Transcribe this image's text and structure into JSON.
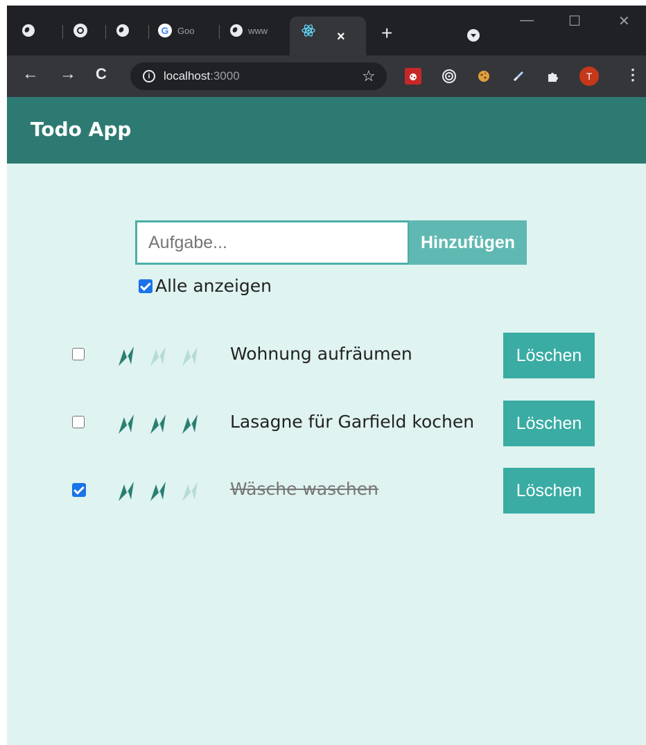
{
  "browser": {
    "tabs": [
      {
        "icon": "globe-icon",
        "title": ""
      },
      {
        "icon": "whatsapp-icon",
        "title": ""
      },
      {
        "icon": "globe-icon",
        "title": ""
      },
      {
        "icon": "google-icon",
        "title": "Goo"
      },
      {
        "icon": "globe-icon",
        "title": "www"
      },
      {
        "icon": "react-icon",
        "title": "",
        "active": true,
        "close": "×"
      }
    ],
    "new_tab": "+",
    "window_controls": {
      "minimize": "—",
      "maximize": "☐",
      "close": "✕"
    },
    "nav": {
      "back": "←",
      "forward": "→",
      "reload": "C"
    },
    "address": {
      "host": "localhost",
      "port": ":3000",
      "info": "i"
    },
    "bookmark_star": "☆",
    "profile_initial": "T",
    "menu": "⋮"
  },
  "app": {
    "title": "Todo App",
    "input_placeholder": "Aufgabe...",
    "add_label": "Hinzufügen",
    "show_all_label": "Alle anzeigen",
    "show_all_checked": true,
    "accent": "#2d7a73",
    "todos": [
      {
        "text": "Wohnung aufräumen",
        "done": false,
        "priority": 1,
        "max_priority": 3,
        "delete_label": "Löschen"
      },
      {
        "text": "Lasagne für Garfield kochen",
        "done": false,
        "priority": 3,
        "max_priority": 3,
        "delete_label": "Löschen"
      },
      {
        "text": "Wäsche waschen",
        "done": true,
        "priority": 2,
        "max_priority": 3,
        "delete_label": "Löschen"
      }
    ]
  }
}
